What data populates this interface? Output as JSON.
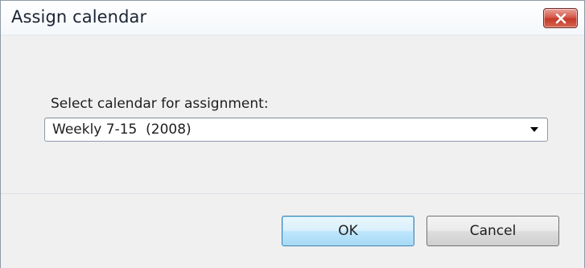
{
  "window": {
    "title": "Assign calendar",
    "close_icon": "close-x-icon"
  },
  "form": {
    "label": "Select calendar for assignment:",
    "selected_calendar": "Weekly 7-15  (2008)",
    "dropdown_icon": "chevron-down-icon"
  },
  "buttons": {
    "ok_label": "OK",
    "cancel_label": "Cancel"
  },
  "colors": {
    "close_button": "#c43a2a",
    "default_button_border": "#3c7fb1",
    "dialog_background": "#f0f0f0"
  }
}
